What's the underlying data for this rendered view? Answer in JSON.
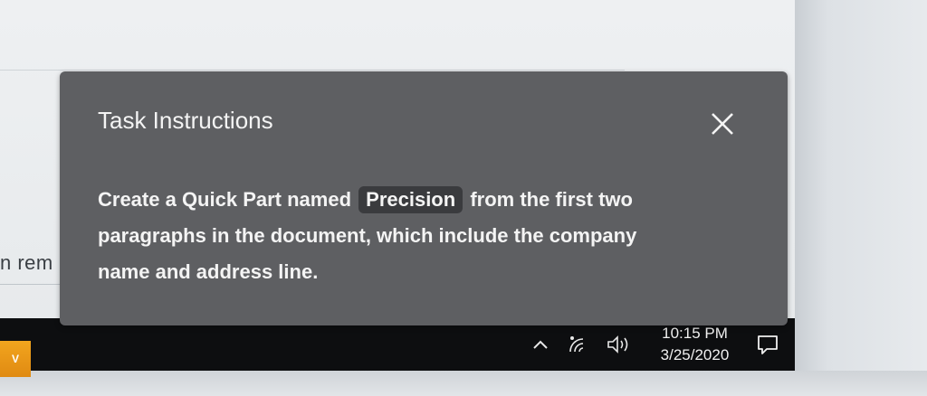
{
  "document": {
    "partial_text": "n rem"
  },
  "popup": {
    "title": "Task Instructions",
    "close_icon": "close-icon",
    "instruction_before": "Create a Quick Part named",
    "instruction_highlight": "Precision",
    "instruction_line1_after": "from the first two",
    "instruction_line2": "paragraphs in the document, which include the company",
    "instruction_line3": "name and address line."
  },
  "taskbar": {
    "button_label": "V",
    "clock_time": "10:15 PM",
    "clock_date": "3/25/2020",
    "tray_icons": [
      "chevron-up-icon",
      "wifi-icon",
      "volume-icon",
      "notification-icon"
    ],
    "colors": {
      "taskbar_bg": "#0d0e10",
      "button_accent": "#f2a51e",
      "popup_bg": "#5e5f62",
      "highlight_bg": "#3a3b3e"
    }
  }
}
